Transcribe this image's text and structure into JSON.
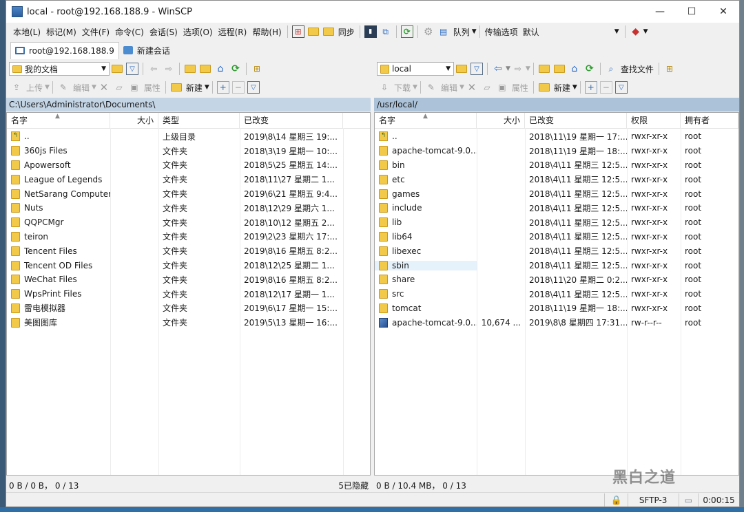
{
  "window": {
    "title": "local - root@192.168.188.9 - WinSCP",
    "min": "—",
    "max": "☐",
    "close": "✕"
  },
  "menu": [
    "本地(L)",
    "标记(M)",
    "文件(F)",
    "命令(C)",
    "会话(S)",
    "选项(O)",
    "远程(R)",
    "帮助(H)"
  ],
  "toolbar": {
    "sync": "同步",
    "queue": "队列",
    "transfer_options_label": "传输选项",
    "transfer_options_value": "默认"
  },
  "tabs": [
    {
      "label": "root@192.168.188.9",
      "active": true
    },
    {
      "label": "新建会话",
      "active": false
    }
  ],
  "left": {
    "location": "我的文档",
    "actions": {
      "upload": "上传",
      "edit": "编辑",
      "props": "属性",
      "new": "新建"
    },
    "path": "C:\\Users\\Administrator\\Documents\\",
    "columns": [
      "名字",
      "大小",
      "类型",
      "已改变"
    ],
    "rows": [
      {
        "name": "..",
        "size": "",
        "type": "上级目录",
        "changed": "2019\\8\\14 星期三 19:...",
        "icon": "up"
      },
      {
        "name": "360js Files",
        "size": "",
        "type": "文件夹",
        "changed": "2018\\3\\19 星期一 10:...",
        "icon": "folder"
      },
      {
        "name": "Apowersoft",
        "size": "",
        "type": "文件夹",
        "changed": "2018\\5\\25 星期五 14:...",
        "icon": "folder"
      },
      {
        "name": "League of Legends",
        "size": "",
        "type": "文件夹",
        "changed": "2018\\11\\27 星期二 1...",
        "icon": "folder"
      },
      {
        "name": "NetSarang Computer",
        "size": "",
        "type": "文件夹",
        "changed": "2019\\6\\21 星期五 9:4...",
        "icon": "folder"
      },
      {
        "name": "Nuts",
        "size": "",
        "type": "文件夹",
        "changed": "2018\\12\\29 星期六 1...",
        "icon": "folder"
      },
      {
        "name": "QQPCMgr",
        "size": "",
        "type": "文件夹",
        "changed": "2018\\10\\12 星期五 2...",
        "icon": "folder"
      },
      {
        "name": "teiron",
        "size": "",
        "type": "文件夹",
        "changed": "2019\\2\\23 星期六 17:...",
        "icon": "folder"
      },
      {
        "name": "Tencent Files",
        "size": "",
        "type": "文件夹",
        "changed": "2019\\8\\16 星期五 8:2...",
        "icon": "folder"
      },
      {
        "name": "Tencent OD Files",
        "size": "",
        "type": "文件夹",
        "changed": "2018\\12\\25 星期二 1...",
        "icon": "folder"
      },
      {
        "name": "WeChat Files",
        "size": "",
        "type": "文件夹",
        "changed": "2019\\8\\16 星期五 8:2...",
        "icon": "folder"
      },
      {
        "name": "WpsPrint Files",
        "size": "",
        "type": "文件夹",
        "changed": "2018\\12\\17 星期一 1...",
        "icon": "folder"
      },
      {
        "name": "雷电模拟器",
        "size": "",
        "type": "文件夹",
        "changed": "2019\\6\\17 星期一 15:...",
        "icon": "folder"
      },
      {
        "name": "美图图库",
        "size": "",
        "type": "文件夹",
        "changed": "2019\\5\\13 星期一 16:...",
        "icon": "folder"
      }
    ],
    "status": "0 B / 0 B，  0 / 13",
    "hidden": "5已隐藏"
  },
  "right": {
    "location": "local",
    "actions": {
      "download": "下载",
      "edit": "编辑",
      "props": "属性",
      "new": "新建",
      "find": "查找文件"
    },
    "path": "/usr/local/",
    "columns": [
      "名字",
      "大小",
      "已改变",
      "权限",
      "拥有者"
    ],
    "rows": [
      {
        "name": "..",
        "size": "",
        "changed": "2018\\11\\19 星期一 17:...",
        "rights": "rwxr-xr-x",
        "owner": "root",
        "icon": "up"
      },
      {
        "name": "apache-tomcat-9.0....",
        "size": "",
        "changed": "2018\\11\\19 星期一 18:...",
        "rights": "rwxr-xr-x",
        "owner": "root",
        "icon": "folder"
      },
      {
        "name": "bin",
        "size": "",
        "changed": "2018\\4\\11 星期三 12:5...",
        "rights": "rwxr-xr-x",
        "owner": "root",
        "icon": "folder"
      },
      {
        "name": "etc",
        "size": "",
        "changed": "2018\\4\\11 星期三 12:5...",
        "rights": "rwxr-xr-x",
        "owner": "root",
        "icon": "folder"
      },
      {
        "name": "games",
        "size": "",
        "changed": "2018\\4\\11 星期三 12:5...",
        "rights": "rwxr-xr-x",
        "owner": "root",
        "icon": "folder"
      },
      {
        "name": "include",
        "size": "",
        "changed": "2018\\4\\11 星期三 12:5...",
        "rights": "rwxr-xr-x",
        "owner": "root",
        "icon": "folder"
      },
      {
        "name": "lib",
        "size": "",
        "changed": "2018\\4\\11 星期三 12:5...",
        "rights": "rwxr-xr-x",
        "owner": "root",
        "icon": "folder"
      },
      {
        "name": "lib64",
        "size": "",
        "changed": "2018\\4\\11 星期三 12:5...",
        "rights": "rwxr-xr-x",
        "owner": "root",
        "icon": "folder"
      },
      {
        "name": "libexec",
        "size": "",
        "changed": "2018\\4\\11 星期三 12:5...",
        "rights": "rwxr-xr-x",
        "owner": "root",
        "icon": "folder"
      },
      {
        "name": "sbin",
        "size": "",
        "changed": "2018\\4\\11 星期三 12:5...",
        "rights": "rwxr-xr-x",
        "owner": "root",
        "icon": "folder",
        "hover": true
      },
      {
        "name": "share",
        "size": "",
        "changed": "2018\\11\\20 星期二 0:2...",
        "rights": "rwxr-xr-x",
        "owner": "root",
        "icon": "folder"
      },
      {
        "name": "src",
        "size": "",
        "changed": "2018\\4\\11 星期三 12:5...",
        "rights": "rwxr-xr-x",
        "owner": "root",
        "icon": "folder"
      },
      {
        "name": "tomcat",
        "size": "",
        "changed": "2018\\11\\19 星期一 18:...",
        "rights": "rwxr-xr-x",
        "owner": "root",
        "icon": "folder"
      },
      {
        "name": "apache-tomcat-9.0....",
        "size": "10,674 ...",
        "changed": "2019\\8\\8 星期四 17:31...",
        "rights": "rw-r--r--",
        "owner": "root",
        "icon": "file"
      }
    ],
    "status": "0 B / 10.4 MB，  0 / 13"
  },
  "statusbar": {
    "protocol": "SFTP-3",
    "elapsed": "0:00:15"
  },
  "watermark": "黑白之道"
}
